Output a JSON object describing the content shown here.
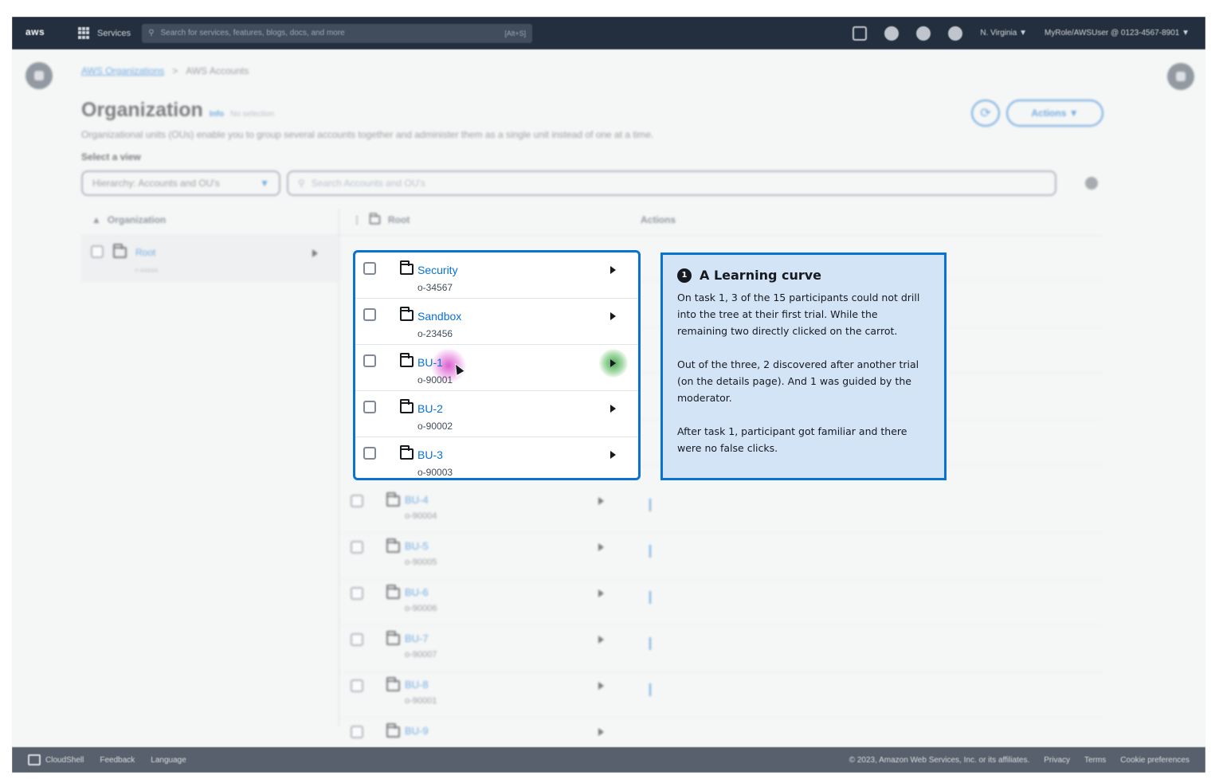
{
  "topnav": {
    "logo": "aws",
    "services_label": "Services",
    "search_placeholder": "Search for services, features, blogs, docs, and more",
    "search_shortcut": "[Alt+S]",
    "region": "N. Virginia ▼",
    "account": "MyRole/AWSUser @ 0123-4567-8901 ▼"
  },
  "breadcrumb": {
    "parent": "AWS Organizations",
    "separator": ">",
    "current": "AWS Accounts"
  },
  "header": {
    "title": "Organization",
    "info": "Info",
    "selection": "No selection",
    "description": "Organizational units (OUs) enable you to group several accounts together and administer them as a single unit instead of one at a time.",
    "actions_label": "Actions ▼",
    "refresh_icon": "refresh-icon"
  },
  "view": {
    "label": "Select a view",
    "selected": "Hierarchy: Accounts and OU's",
    "caret": "▼",
    "search_placeholder": "Search Accounts and OU's"
  },
  "columns": {
    "organization": "Organization",
    "root": "Root",
    "actions": "Actions"
  },
  "left_tree": {
    "root_label": "Root",
    "root_id": "r-xxxxx"
  },
  "focused_rows": [
    {
      "name": "Security",
      "id": "o-34567"
    },
    {
      "name": "Sandbox",
      "id": "o-23456"
    },
    {
      "name": "BU-1",
      "id": "o-90001"
    },
    {
      "name": "BU-2",
      "id": "o-90002"
    },
    {
      "name": "BU-3",
      "id": "o-90003"
    }
  ],
  "faded_rows": [
    {
      "name": "BU-4",
      "id": "o-90004"
    },
    {
      "name": "BU-5",
      "id": "o-90005"
    },
    {
      "name": "BU-6",
      "id": "o-90006"
    },
    {
      "name": "BU-7",
      "id": "o-90007"
    },
    {
      "name": "BU-8",
      "id": "o-90001"
    },
    {
      "name": "BU-9",
      "id": ""
    }
  ],
  "annotation": {
    "step": "1",
    "title": "A Learning curve",
    "paragraphs": [
      "On task 1, 3 of the 15 participants could not drill into the tree at their first trial. While the remaining two directly clicked on the carrot.",
      "Out of the three, 2 discovered after another trial (on the details page). And 1 was guided by the moderator.",
      "After task 1, participant got familiar and there were no false clicks."
    ]
  },
  "footer": {
    "cloudshell": "CloudShell",
    "feedback": "Feedback",
    "language": "Language",
    "copyright": "© 2023, Amazon Web Services, Inc. or its affiliates.",
    "privacy": "Privacy",
    "terms": "Terms",
    "cookies": "Cookie preferences"
  },
  "colors": {
    "accent": "#0972d3",
    "nav_bg": "#232f3e",
    "annotation_bg": "#d4e4f7",
    "click_highlight": "#d643c7",
    "expand_highlight": "#3da047"
  }
}
